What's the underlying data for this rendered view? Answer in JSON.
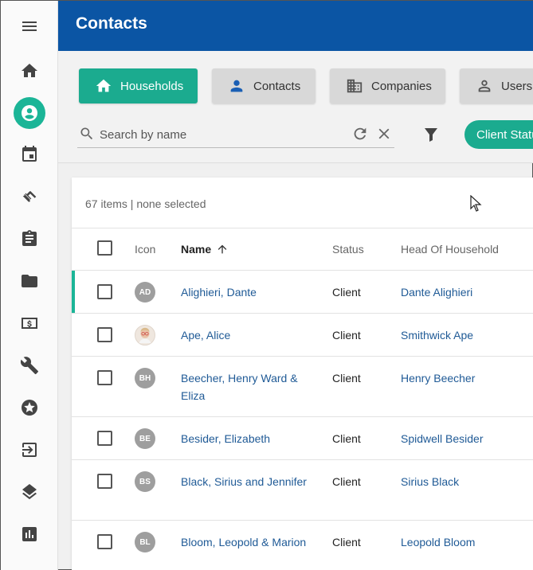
{
  "header": {
    "title": "Contacts"
  },
  "sidebar": {
    "items": [
      {
        "icon": "menu-icon"
      },
      {
        "icon": "home-icon"
      },
      {
        "icon": "account-circle-icon",
        "active": true
      },
      {
        "icon": "calendar-icon"
      },
      {
        "icon": "handshake-icon"
      },
      {
        "icon": "clipboard-icon"
      },
      {
        "icon": "folder-icon"
      },
      {
        "icon": "money-icon"
      },
      {
        "icon": "wrench-icon"
      },
      {
        "icon": "star-icon"
      },
      {
        "icon": "login-icon"
      },
      {
        "icon": "layers-icon"
      },
      {
        "icon": "chart-icon"
      }
    ]
  },
  "tabs": {
    "households": "Households",
    "contacts": "Contacts",
    "companies": "Companies",
    "users": "Users"
  },
  "search": {
    "placeholder": "Search by name",
    "value": ""
  },
  "filter_chip": "Client Statu",
  "list": {
    "count_text": "67 items | none selected",
    "columns": {
      "icon": "Icon",
      "name": "Name",
      "status": "Status",
      "head": "Head Of Household"
    },
    "rows": [
      {
        "initials": "AD",
        "name": "Alighieri, Dante",
        "status": "Client",
        "head": "Dante Alighieri"
      },
      {
        "initials": "",
        "name": "Ape, Alice",
        "status": "Client",
        "head": "Smithwick Ape"
      },
      {
        "initials": "BH",
        "name": "Beecher, Henry Ward & Eliza",
        "status": "Client",
        "head": "Henry Beecher"
      },
      {
        "initials": "BE",
        "name": "Besider, Elizabeth",
        "status": "Client",
        "head": "Spidwell Besider"
      },
      {
        "initials": "BS",
        "name": "Black, Sirius and Jennifer",
        "status": "Client",
        "head": "Sirius Black"
      },
      {
        "initials": "BL",
        "name": "Bloom, Leopold & Marion",
        "status": "Client",
        "head": "Leopold Bloom"
      }
    ]
  },
  "colors": {
    "brand": "#0b55a4",
    "accent": "#1bab8f",
    "link": "#1f5a96"
  }
}
